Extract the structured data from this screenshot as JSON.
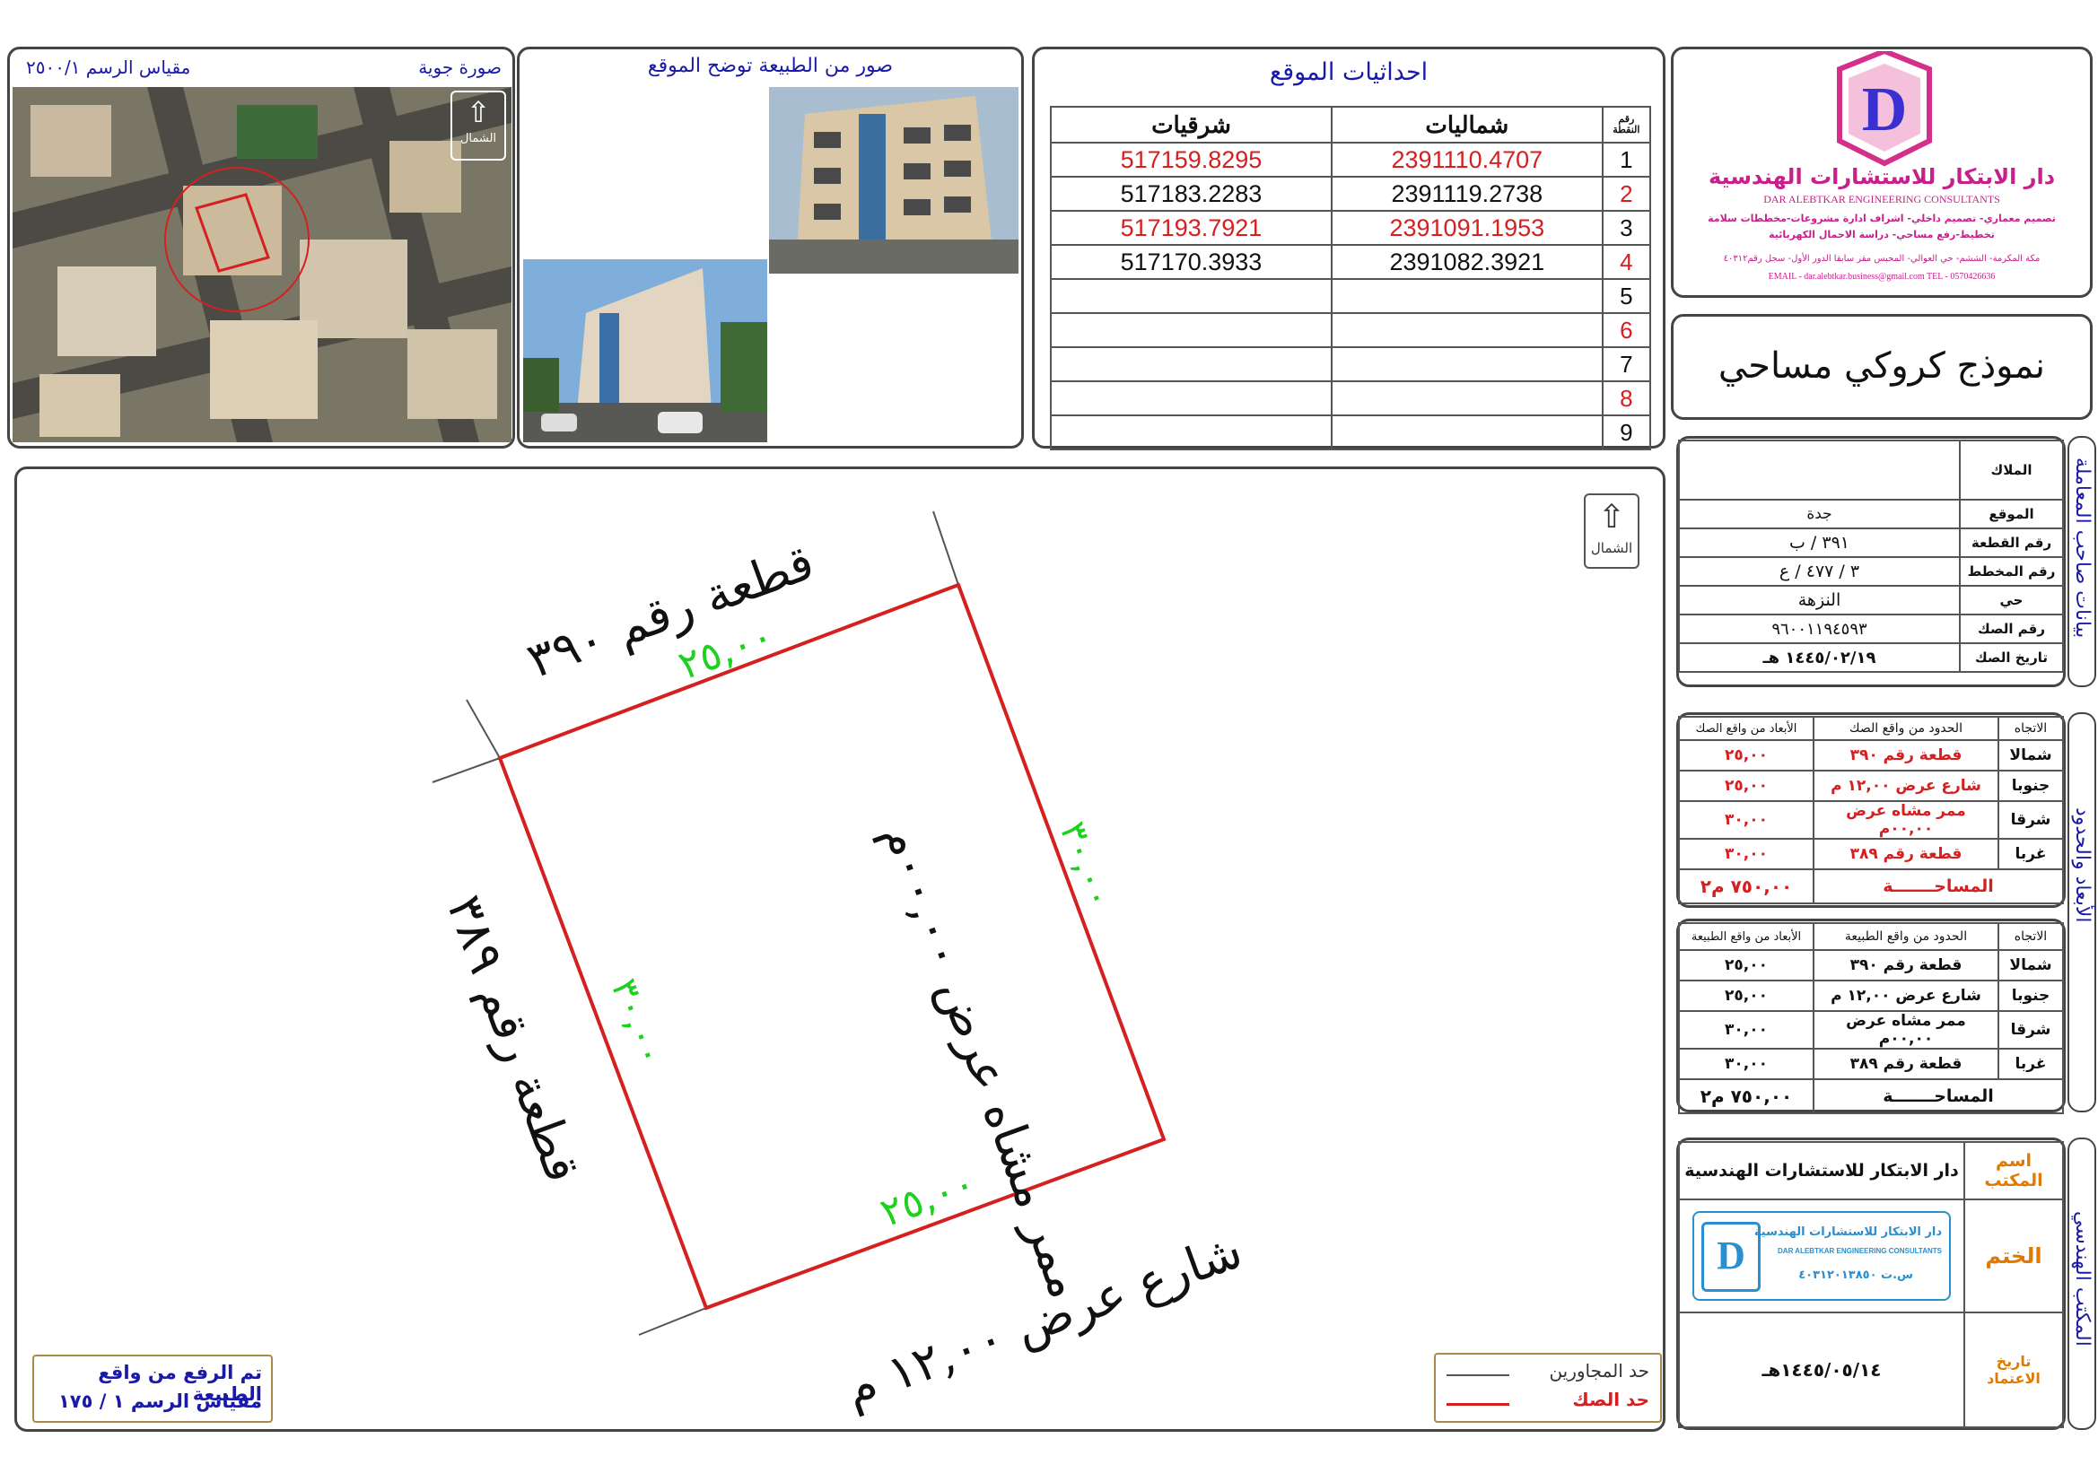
{
  "aerial": {
    "title": "صورة جوية",
    "scale": "مقياس الرسم ٢٥٠٠/١",
    "north": "الشمال"
  },
  "photos": {
    "title": "صور من الطبيعة توضح الموقع"
  },
  "coords": {
    "title": "احداثيات الموقع",
    "col_num": "رقم النقطة",
    "col_north": "شماليات",
    "col_east": "شرقيات",
    "rows": [
      {
        "n": "1",
        "north": "2391110.4707",
        "east": "517159.8295"
      },
      {
        "n": "2",
        "north": "2391119.2738",
        "east": "517183.2283"
      },
      {
        "n": "3",
        "north": "2391091.1953",
        "east": "517193.7921"
      },
      {
        "n": "4",
        "north": "2391082.3921",
        "east": "517170.3933"
      },
      {
        "n": "5",
        "north": "",
        "east": ""
      },
      {
        "n": "6",
        "north": "",
        "east": ""
      },
      {
        "n": "7",
        "north": "",
        "east": ""
      },
      {
        "n": "8",
        "north": "",
        "east": ""
      },
      {
        "n": "9",
        "north": "",
        "east": ""
      }
    ]
  },
  "office": {
    "name_ar": "دار الابتكار للاستشارات الهندسية",
    "name_en": "DAR ALEBTKAR ENGINEERING CONSULTANTS",
    "line1": "تصميم معماري- تصميم داخلي- اشراف ادارة مشروعات-مخططات سلامة",
    "line2": "تخطيط-رفع مساحي- دراسة الاحمال الكهربائية",
    "line3": "مكة المكرمة- الششم- حي العوالي- المحبس مقر سابقا الدور الأول- سجل رقم٤٠٣١٢",
    "line4": "EMAIL - dar.alebtkar.business@gmail.com    TEL - 0570426636"
  },
  "form_title": "نموذج كروكي مساحي",
  "owner": {
    "side_label": "بيانات صاحب المعاملة",
    "rows": [
      {
        "label": "الملاك",
        "value": ""
      },
      {
        "label": "الموقع",
        "value": "جدة"
      },
      {
        "label": "رقم القطعة",
        "value": "٣٩١ / ب"
      },
      {
        "label": "رقم المخطط",
        "value": "٣ / ٤٧٧ / ع"
      },
      {
        "label": "حي",
        "value": "النزهة"
      },
      {
        "label": "رقم الصك",
        "value": "٩٦٠٠١١٩٤٥٩٣"
      },
      {
        "label": "تاريخ الصك",
        "value": "١٤٤٥/٠٢/١٩ هـ"
      }
    ]
  },
  "bounds_deed": {
    "side_label": "الأبعاد والحدود",
    "h_dir": "الاتجاه",
    "h_bound": "الحدود من واقع الصك",
    "h_dim": "الأبعاد من واقع الصك",
    "rows": [
      {
        "dir": "شمالا",
        "bound": "قطعة رقم ٣٩٠",
        "dim": "٢٥,٠٠"
      },
      {
        "dir": "جنوبا",
        "bound": "شارع عرض ١٢,٠٠ م",
        "dim": "٢٥,٠٠"
      },
      {
        "dir": "شرقا",
        "bound": "ممر مشاه عرض ٠٠,٠٠م",
        "dim": "٣٠,٠٠"
      },
      {
        "dir": "غربا",
        "bound": "قطعة رقم ٣٨٩",
        "dim": "٣٠,٠٠"
      }
    ],
    "area_label": "المساحـــــــة",
    "area_value": "٧٥٠,٠٠ م٢"
  },
  "bounds_nature": {
    "h_dir": "الاتجاه",
    "h_bound": "الحدود من واقع الطبيعة",
    "h_dim": "الأبعاد من واقع الطبيعة",
    "rows": [
      {
        "dir": "شمالا",
        "bound": "قطعة رقم ٣٩٠",
        "dim": "٢٥,٠٠"
      },
      {
        "dir": "جنوبا",
        "bound": "شارع عرض ١٢,٠٠ م",
        "dim": "٢٥,٠٠"
      },
      {
        "dir": "شرقا",
        "bound": "ممر مشاه عرض ٠٠,٠٠م",
        "dim": "٣٠,٠٠"
      },
      {
        "dir": "غربا",
        "bound": "قطعة رقم ٣٨٩",
        "dim": "٣٠,٠٠"
      }
    ],
    "area_label": "المساحـــــــة",
    "area_value": "٧٥٠,٠٠ م٢"
  },
  "eng_office": {
    "side_label": "المكتب الهندسي",
    "name_label": "اسم المكتب",
    "name_value": "دار الابتكار للاستشارات الهندسية",
    "stamp_label": "الختم",
    "stamp_ar": "دار الابتكار للاستشارات الهندسية",
    "stamp_en": "DAR ALEBTKAR ENGINEERING CONSULTANTS",
    "stamp_cr": "س.ت ٤٠٣١٢٠١٣٨٥٠",
    "date_label": "تاريخ الاعتماد",
    "date_value": "١٤٤٥/٠٥/١٤هـ"
  },
  "plan": {
    "north": "الشمال",
    "north_label": "قطعة رقم ٣٩٠",
    "south_label": "شارع عرض ١٢,٠٠ م",
    "east_label": "ممر مشاه عرض ٠٠,٠٠م",
    "west_label": "قطعة رقم ٣٨٩",
    "dim_top": "٢٥,٠٠",
    "dim_bottom": "٢٥,٠٠",
    "dim_right": "٣٠,٠٠",
    "dim_left": "٣٠,٠٠",
    "survey_note": "تم الرفع من واقع الطبيعة",
    "scale_note": "مقياس الرسم ١ / ١٧٥",
    "legend_neighbors": "حد المجاورين",
    "legend_deed": "حد الصك"
  },
  "colors": {
    "border": "#444444",
    "blue_text": "#1a1aa8",
    "red_line": "#d42020",
    "green_dim": "#1fd11f",
    "orange_label": "#e07a00"
  }
}
